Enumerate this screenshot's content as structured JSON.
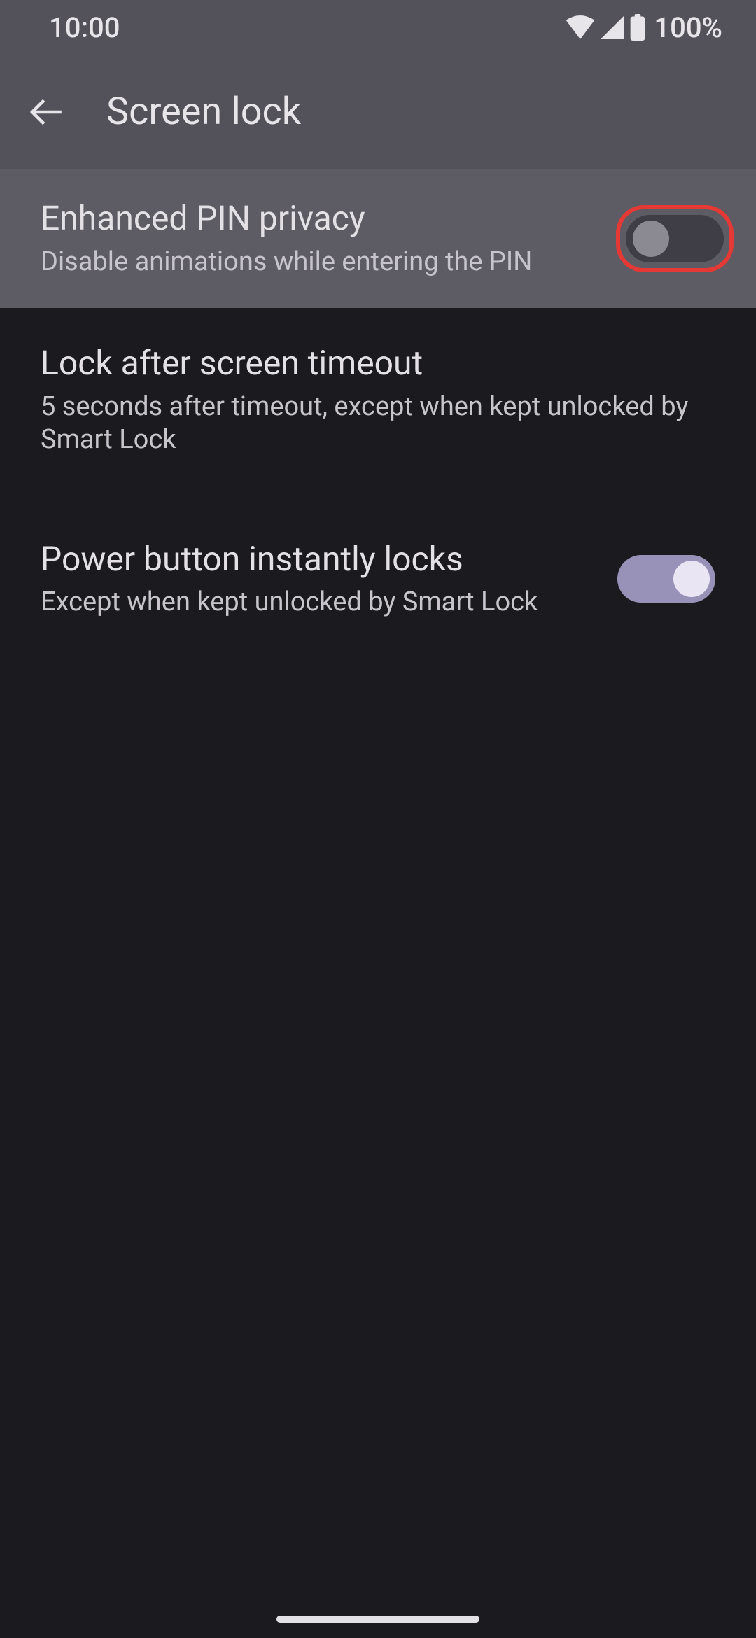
{
  "statusBar": {
    "time": "10:00",
    "batteryPercent": "100%"
  },
  "header": {
    "title": "Screen lock"
  },
  "settings": [
    {
      "title": "Enhanced PIN privacy",
      "subtitle": "Disable animations while entering the PIN",
      "toggle": "off",
      "highlighted": true
    },
    {
      "title": "Lock after screen timeout",
      "subtitle": "5 seconds after timeout, except when kept unlocked by Smart Lock"
    },
    {
      "title": "Power button instantly locks",
      "subtitle": "Except when kept unlocked by Smart Lock",
      "toggle": "on"
    }
  ]
}
